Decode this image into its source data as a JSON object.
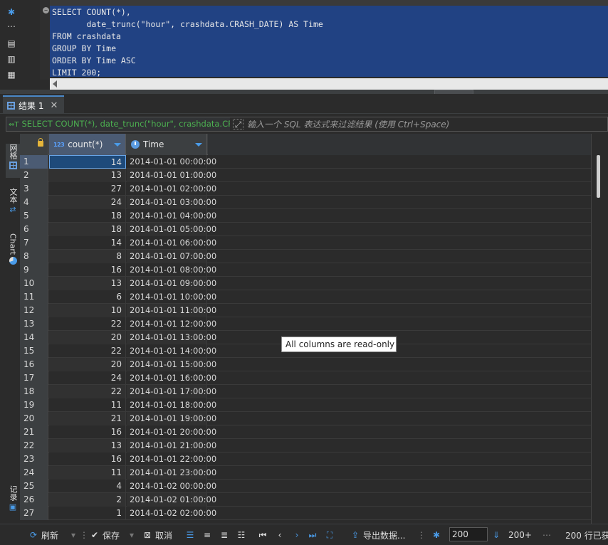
{
  "editor": {
    "sql_lines": [
      "SELECT COUNT(*),",
      "       date_trunc(\"hour\", crashdata.CRASH_DATE) AS Time",
      "FROM crashdata",
      "GROUP BY Time",
      "ORDER BY Time ASC",
      "LIMIT 200;"
    ]
  },
  "results_tab": {
    "label": "结果 1"
  },
  "filter": {
    "query_text": "SELECT COUNT(*), date_trunc(\"hour\", crashdata.CR",
    "placeholder": "输入一个 SQL 表达式来过滤结果 (使用 Ctrl+Space)"
  },
  "side_tabs": {
    "grid": "网格",
    "text": "文本",
    "chart": "Chart",
    "record": "记录"
  },
  "grid": {
    "columns": [
      {
        "label": "count(*)",
        "type_badge": "123"
      },
      {
        "label": "Time"
      }
    ],
    "rows": [
      {
        "n": "1",
        "count": "14",
        "time": "2014-01-01 00:00:00"
      },
      {
        "n": "2",
        "count": "13",
        "time": "2014-01-01 01:00:00"
      },
      {
        "n": "3",
        "count": "27",
        "time": "2014-01-01 02:00:00"
      },
      {
        "n": "4",
        "count": "24",
        "time": "2014-01-01 03:00:00"
      },
      {
        "n": "5",
        "count": "18",
        "time": "2014-01-01 04:00:00"
      },
      {
        "n": "6",
        "count": "18",
        "time": "2014-01-01 05:00:00"
      },
      {
        "n": "7",
        "count": "14",
        "time": "2014-01-01 06:00:00"
      },
      {
        "n": "8",
        "count": "8",
        "time": "2014-01-01 07:00:00"
      },
      {
        "n": "9",
        "count": "16",
        "time": "2014-01-01 08:00:00"
      },
      {
        "n": "10",
        "count": "13",
        "time": "2014-01-01 09:00:00"
      },
      {
        "n": "11",
        "count": "6",
        "time": "2014-01-01 10:00:00"
      },
      {
        "n": "12",
        "count": "10",
        "time": "2014-01-01 11:00:00"
      },
      {
        "n": "13",
        "count": "22",
        "time": "2014-01-01 12:00:00"
      },
      {
        "n": "14",
        "count": "20",
        "time": "2014-01-01 13:00:00"
      },
      {
        "n": "15",
        "count": "22",
        "time": "2014-01-01 14:00:00"
      },
      {
        "n": "16",
        "count": "20",
        "time": "2014-01-01 15:00:00"
      },
      {
        "n": "17",
        "count": "24",
        "time": "2014-01-01 16:00:00"
      },
      {
        "n": "18",
        "count": "22",
        "time": "2014-01-01 17:00:00"
      },
      {
        "n": "19",
        "count": "11",
        "time": "2014-01-01 18:00:00"
      },
      {
        "n": "20",
        "count": "21",
        "time": "2014-01-01 19:00:00"
      },
      {
        "n": "21",
        "count": "16",
        "time": "2014-01-01 20:00:00"
      },
      {
        "n": "22",
        "count": "13",
        "time": "2014-01-01 21:00:00"
      },
      {
        "n": "23",
        "count": "16",
        "time": "2014-01-01 22:00:00"
      },
      {
        "n": "24",
        "count": "11",
        "time": "2014-01-01 23:00:00"
      },
      {
        "n": "25",
        "count": "4",
        "time": "2014-01-02 00:00:00"
      },
      {
        "n": "26",
        "count": "2",
        "time": "2014-01-02 01:00:00"
      },
      {
        "n": "27",
        "count": "1",
        "time": "2014-01-02 02:00:00"
      }
    ]
  },
  "tooltip": "All columns are read-only",
  "toolbar": {
    "refresh": "刷新",
    "save": "保存",
    "cancel": "取消",
    "export": "导出数据...",
    "page_size": "200",
    "fetch_more": "200+",
    "status": "200 行已获"
  }
}
